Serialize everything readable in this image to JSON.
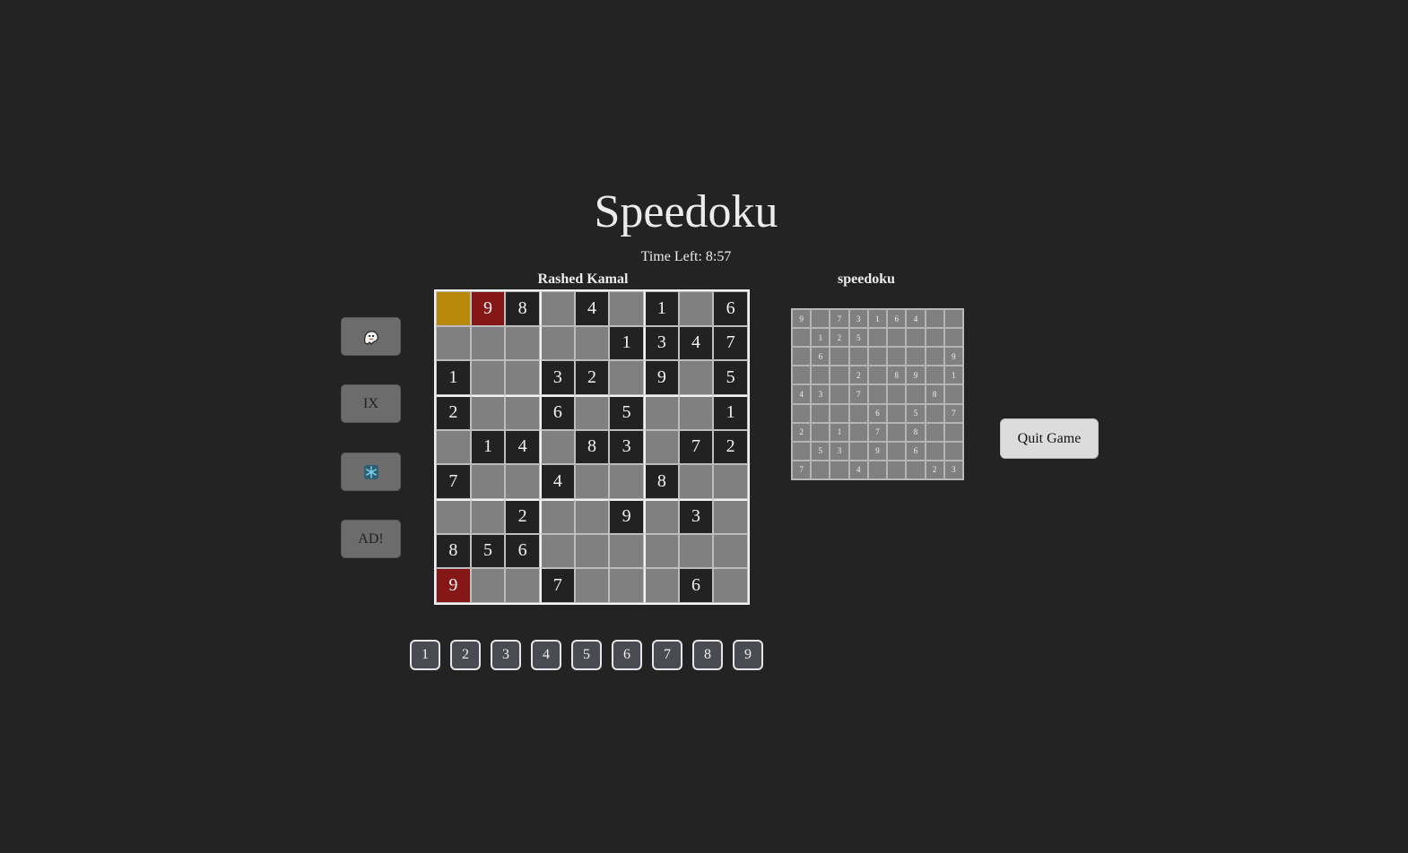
{
  "app": {
    "title": "Speedoku",
    "timer_text": "Time Left: 8:57"
  },
  "player": {
    "name": "Rashed Kamal"
  },
  "opponent": {
    "name": "speedoku"
  },
  "powerups": [
    {
      "key": "ghost",
      "label": "",
      "icon": "ghost-icon"
    },
    {
      "key": "ix",
      "label": "IX",
      "icon": ""
    },
    {
      "key": "freeze",
      "label": "",
      "icon": "snowflake-icon"
    },
    {
      "key": "ad",
      "label": "AD!",
      "icon": ""
    }
  ],
  "board": [
    [
      "",
      "9",
      "8",
      "",
      "4",
      "",
      "1",
      "",
      "6"
    ],
    [
      "",
      "",
      "",
      "",
      "",
      "1",
      "3",
      "4",
      "7"
    ],
    [
      "1",
      "",
      "",
      "3",
      "2",
      "",
      "9",
      "",
      "5"
    ],
    [
      "2",
      "",
      "",
      "6",
      "",
      "5",
      "",
      "",
      "1"
    ],
    [
      "",
      "1",
      "4",
      "",
      "8",
      "3",
      "",
      "7",
      "2"
    ],
    [
      "7",
      "",
      "",
      "4",
      "",
      "",
      "8",
      "",
      ""
    ],
    [
      "",
      "",
      "2",
      "",
      "",
      "9",
      "",
      "3",
      ""
    ],
    [
      "8",
      "5",
      "6",
      "",
      "",
      "",
      "",
      "",
      ""
    ],
    [
      "9",
      "",
      "",
      "7",
      "",
      "",
      "",
      "6",
      ""
    ]
  ],
  "cell_states": [
    [
      "selected",
      "error",
      "given",
      "empty",
      "given",
      "empty",
      "given",
      "empty",
      "given"
    ],
    [
      "empty",
      "empty",
      "empty",
      "empty",
      "empty",
      "given",
      "given",
      "given",
      "given"
    ],
    [
      "given",
      "empty",
      "empty",
      "given",
      "given",
      "empty",
      "given",
      "empty",
      "given"
    ],
    [
      "given",
      "empty",
      "empty",
      "given",
      "empty",
      "given",
      "empty",
      "empty",
      "given"
    ],
    [
      "empty",
      "given",
      "given",
      "empty",
      "given",
      "given",
      "empty",
      "given",
      "given"
    ],
    [
      "given",
      "empty",
      "empty",
      "given",
      "empty",
      "empty",
      "given",
      "empty",
      "empty"
    ],
    [
      "empty",
      "empty",
      "given",
      "empty",
      "empty",
      "given",
      "empty",
      "given",
      "empty"
    ],
    [
      "given",
      "given",
      "given",
      "empty",
      "empty",
      "empty",
      "empty",
      "empty",
      "empty"
    ],
    [
      "error",
      "empty",
      "empty",
      "given",
      "empty",
      "empty",
      "empty",
      "given",
      "empty"
    ]
  ],
  "opponent_board": [
    [
      "9",
      "",
      "7",
      "3",
      "1",
      "6",
      "4",
      "",
      ""
    ],
    [
      "",
      "1",
      "2",
      "5",
      "",
      "",
      "",
      "",
      ""
    ],
    [
      "",
      "6",
      "",
      "",
      "",
      "",
      "",
      "",
      "9"
    ],
    [
      "",
      "",
      "",
      "2",
      "",
      "8",
      "9",
      "",
      "1"
    ],
    [
      "4",
      "3",
      "",
      "7",
      "",
      "",
      "",
      "8",
      ""
    ],
    [
      "",
      "",
      "",
      "",
      "6",
      "",
      "5",
      "",
      "7"
    ],
    [
      "2",
      "",
      "1",
      "",
      "7",
      "",
      "8",
      "",
      ""
    ],
    [
      "",
      "5",
      "3",
      "",
      "9",
      "",
      "6",
      "",
      ""
    ],
    [
      "7",
      "",
      "",
      "4",
      "",
      "",
      "",
      "2",
      "3"
    ]
  ],
  "numpad": [
    "1",
    "2",
    "3",
    "4",
    "5",
    "6",
    "7",
    "8",
    "9"
  ],
  "quit_label": "Quit Game",
  "colors": {
    "background": "#232323",
    "given_cell": "#222222",
    "empty_cell": "#808080",
    "error_cell": "#861717",
    "selected_cell": "#b8890a",
    "freeze_icon": "#3a9fc0"
  }
}
